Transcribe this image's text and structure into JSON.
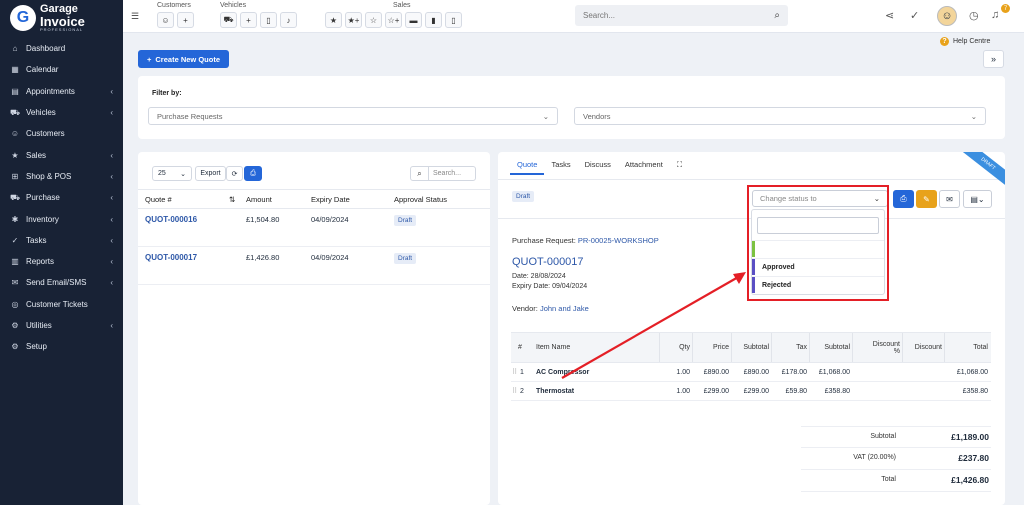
{
  "app": {
    "logo_line1": "Garage",
    "logo_line2": "Invoice",
    "logo_line3": "PROFESSIONAL"
  },
  "sidebar": {
    "items": [
      {
        "label": "Dashboard",
        "icon": "home-icon",
        "glyph": "⌂",
        "chevron": false
      },
      {
        "label": "Calendar",
        "icon": "calendar-icon",
        "glyph": "▦",
        "chevron": false
      },
      {
        "label": "Appointments",
        "icon": "briefcase-icon",
        "glyph": "▤",
        "chevron": true
      },
      {
        "label": "Vehicles",
        "icon": "car-icon",
        "glyph": "⛟",
        "chevron": true
      },
      {
        "label": "Customers",
        "icon": "user-icon",
        "glyph": "☺",
        "chevron": false
      },
      {
        "label": "Sales",
        "icon": "star-icon",
        "glyph": "★",
        "chevron": true
      },
      {
        "label": "Shop & POS",
        "icon": "cart-icon",
        "glyph": "⊞",
        "chevron": true
      },
      {
        "label": "Purchase",
        "icon": "truck-icon",
        "glyph": "⛟",
        "chevron": true
      },
      {
        "label": "Inventory",
        "icon": "box-icon",
        "glyph": "✱",
        "chevron": true
      },
      {
        "label": "Tasks",
        "icon": "check-circle-icon",
        "glyph": "✓",
        "chevron": true
      },
      {
        "label": "Reports",
        "icon": "chart-icon",
        "glyph": "▥",
        "chevron": true
      },
      {
        "label": "Send Email/SMS",
        "icon": "envelope-icon",
        "glyph": "✉",
        "chevron": true
      },
      {
        "label": "Customer Tickets",
        "icon": "ticket-icon",
        "glyph": "◎",
        "chevron": false
      },
      {
        "label": "Utilities",
        "icon": "tools-icon",
        "glyph": "⚙",
        "chevron": true
      },
      {
        "label": "Setup",
        "icon": "gear-icon",
        "glyph": "⚙",
        "chevron": false
      }
    ]
  },
  "topbar": {
    "groups": [
      {
        "label": "Customers",
        "buttons": [
          "☺",
          "+"
        ]
      },
      {
        "label": "Vehicles",
        "buttons": [
          "⛟",
          "+",
          "▯",
          "♪"
        ]
      },
      {
        "label": "Sales",
        "buttons": [
          "★",
          "★+",
          "☆",
          "☆+",
          "▬",
          "▮",
          "▯"
        ]
      }
    ],
    "search_placeholder": "Search...",
    "notification_count": "7"
  },
  "help": {
    "label": "Help Centre"
  },
  "create_button": "Create New Quote",
  "filter": {
    "title": "Filter by:",
    "purchase_requests_placeholder": "Purchase Requests",
    "vendors_placeholder": "Vendors"
  },
  "list": {
    "page_size": "25",
    "export_label": "Export",
    "search_placeholder": "Search...",
    "columns": [
      "Quote #",
      "Amount",
      "Expiry Date",
      "Approval Status"
    ],
    "rows": [
      {
        "quote": "QUOT-000016",
        "amount": "£1,504.80",
        "expiry": "04/09/2024",
        "status": "Draft"
      },
      {
        "quote": "QUOT-000017",
        "amount": "£1,426.80",
        "expiry": "04/09/2024",
        "status": "Draft"
      }
    ]
  },
  "detail": {
    "tabs": [
      "Quote",
      "Tasks",
      "Discuss",
      "Attachment"
    ],
    "ribbon": "DRAFT",
    "status_badge": "Draft",
    "status_select_placeholder": "Change status to",
    "status_options": [
      {
        "label": "",
        "color": "#7cc242"
      },
      {
        "label": "Approved",
        "color": "#5a4fc4"
      },
      {
        "label": "Rejected",
        "color": "#5a4fc4"
      }
    ],
    "purchase_request_label": "Purchase Request:",
    "purchase_request_value": "PR-00025-WORKSHOP",
    "quote_number": "QUOT-000017",
    "date_line": "Date: 28/08/2024",
    "expiry_line": "Expiry Date: 09/04/2024",
    "vendor_label": "Vendor:",
    "vendor_value": "John and Jake",
    "item_columns": {
      "num": "#",
      "name": "Item Name",
      "qty": "Qty",
      "price": "Price",
      "subtotal": "Subtotal",
      "tax": "Tax",
      "subtotal2": "Subtotal",
      "discount_pct_1": "Discount",
      "discount_pct_2": "%",
      "discount": "Discount",
      "total": "Total"
    },
    "items": [
      {
        "num": "1",
        "name": "AC Compressor",
        "qty": "1.00",
        "price": "£890.00",
        "subtotal": "£890.00",
        "tax": "£178.00",
        "subtotal2": "£1,068.00",
        "discount_pct": "",
        "discount": "",
        "total": "£1,068.00"
      },
      {
        "num": "2",
        "name": "Thermostat",
        "qty": "1.00",
        "price": "£299.00",
        "subtotal": "£299.00",
        "tax": "£59.80",
        "subtotal2": "£358.80",
        "discount_pct": "",
        "discount": "",
        "total": "£358.80"
      }
    ],
    "totals": [
      {
        "label": "Subtotal",
        "value": "£1,189.00"
      },
      {
        "label": "VAT (20.00%)",
        "value": "£237.80"
      },
      {
        "label": "Total",
        "value": "£1,426.80"
      }
    ]
  },
  "annotation": {
    "highlight_color": "#e41f26"
  }
}
